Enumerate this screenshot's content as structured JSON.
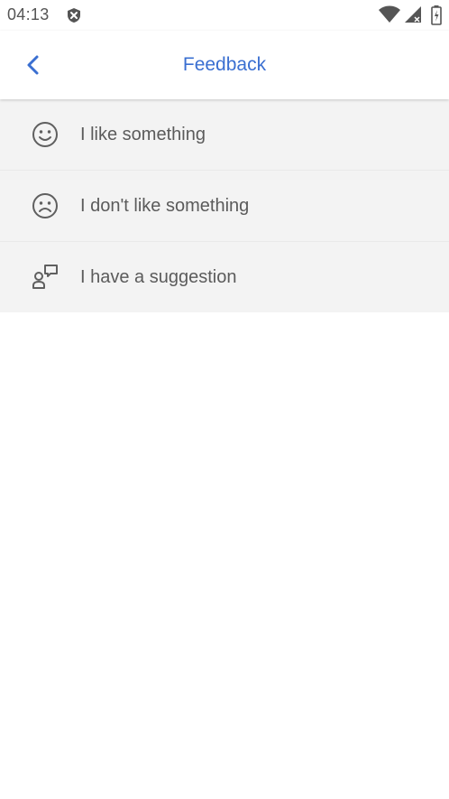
{
  "status_bar": {
    "time": "04:13",
    "icons": [
      "shield-icon",
      "wifi-icon",
      "cellular-signal-icon",
      "battery-icon"
    ]
  },
  "app_bar": {
    "title": "Feedback",
    "back_icon": "chevron-left-icon",
    "accent_color": "#3a6fd1"
  },
  "menu": {
    "items": [
      {
        "label": "I like something",
        "icon": "smiley-happy-icon"
      },
      {
        "label": "I don't like something",
        "icon": "smiley-sad-icon"
      },
      {
        "label": "I have a suggestion",
        "icon": "suggestion-icon"
      }
    ]
  }
}
